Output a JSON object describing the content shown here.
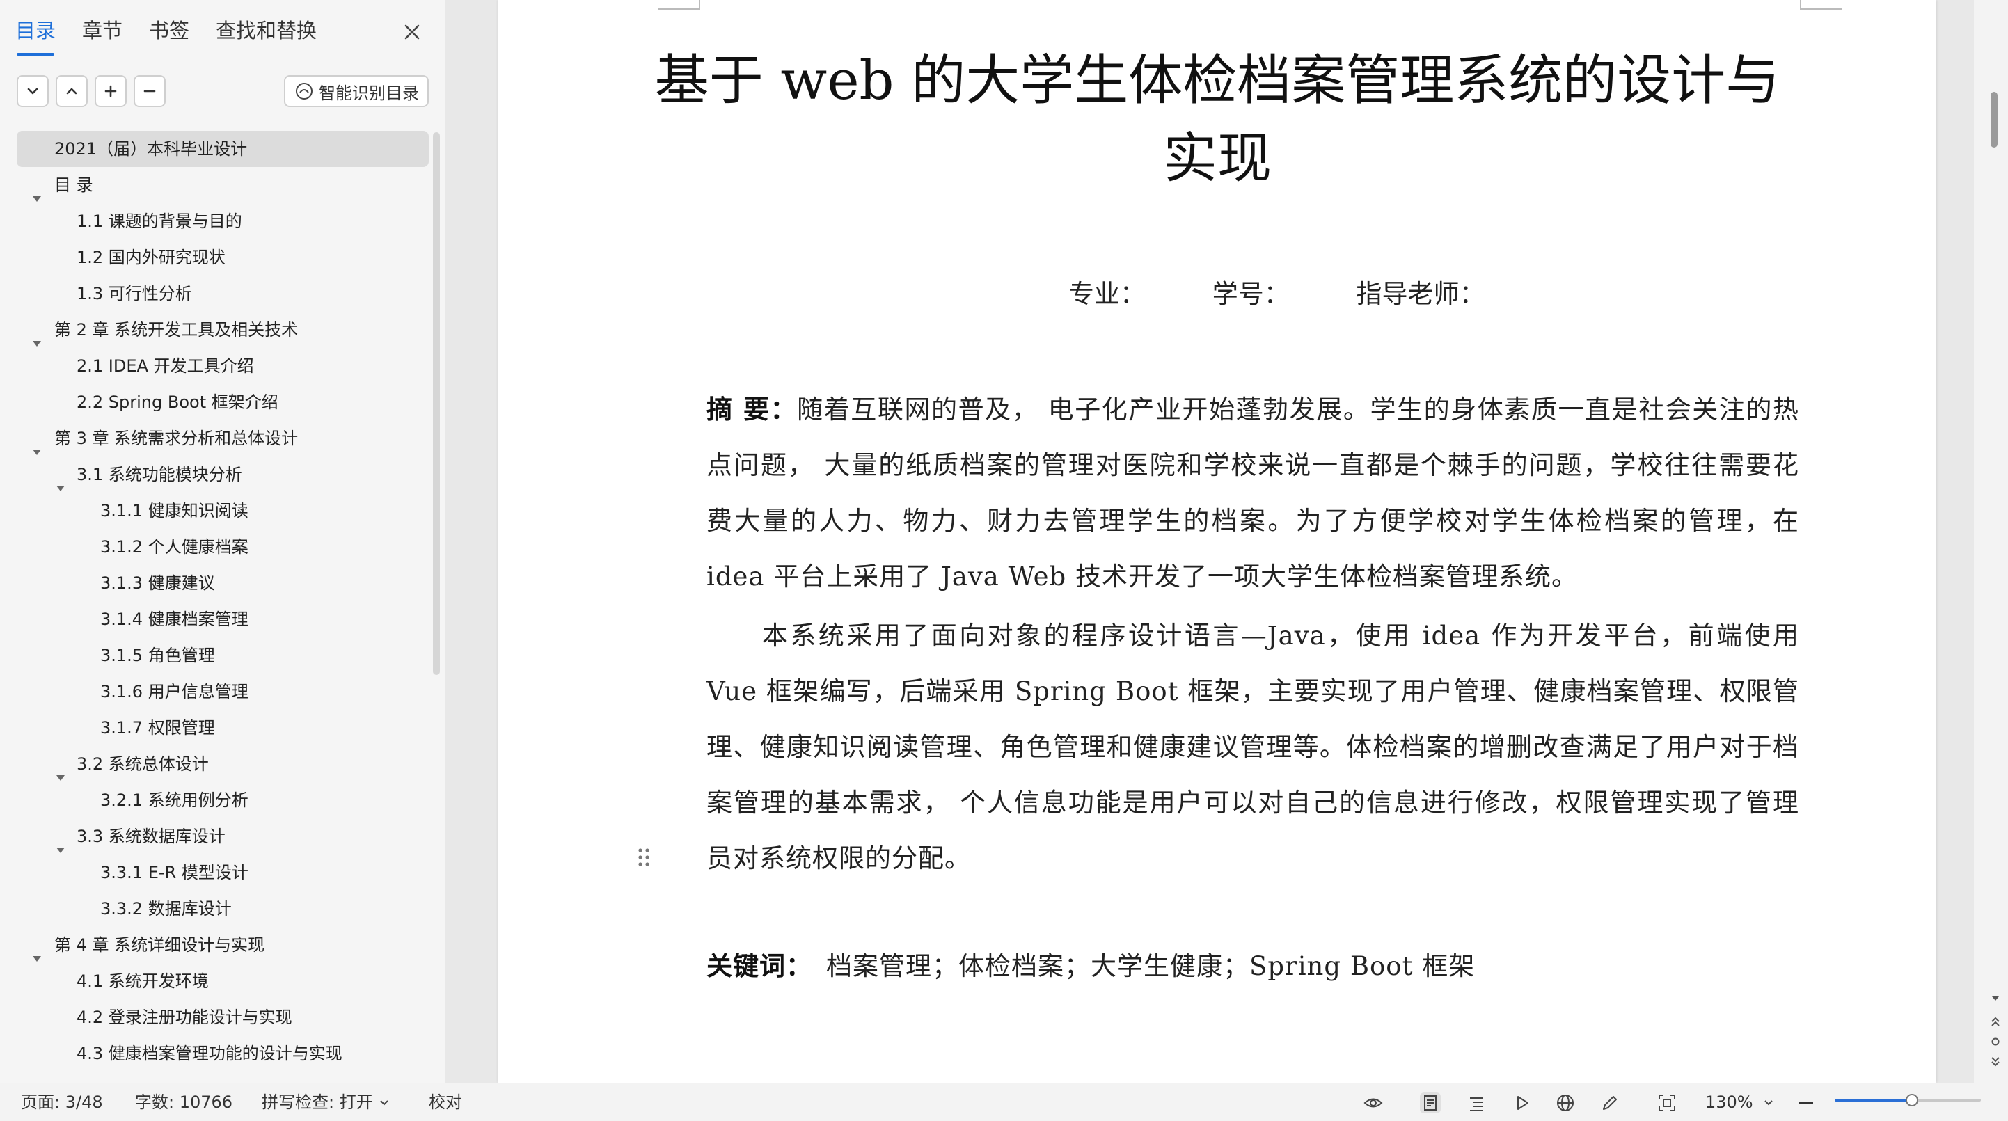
{
  "sidebar": {
    "tabs": [
      {
        "label": "目录",
        "active": true
      },
      {
        "label": "章节"
      },
      {
        "label": "书签"
      },
      {
        "label": "查找和替换"
      }
    ],
    "smart_button": "智能识别目录",
    "toc": [
      {
        "label": "2021（届）本科毕业设计",
        "level": 0,
        "expanded": null,
        "selected": true
      },
      {
        "label": "目  录",
        "level": 0,
        "expanded": true
      },
      {
        "label": "1.1 课题的背景与目的",
        "level": 1
      },
      {
        "label": "1.2 国内外研究现状",
        "level": 1
      },
      {
        "label": "1.3 可行性分析",
        "level": 1
      },
      {
        "label": "第 2 章 系统开发工具及相关技术",
        "level": 0,
        "expanded": true
      },
      {
        "label": "2.1 IDEA 开发工具介绍",
        "level": 1
      },
      {
        "label": "2.2  Spring Boot 框架介绍",
        "level": 1
      },
      {
        "label": "第 3 章 系统需求分析和总体设计",
        "level": 0,
        "expanded": true
      },
      {
        "label": "3.1 系统功能模块分析",
        "level": 1,
        "expanded": true
      },
      {
        "label": "3.1.1 健康知识阅读",
        "level": 2
      },
      {
        "label": "3.1.2 个人健康档案",
        "level": 2
      },
      {
        "label": "3.1.3 健康建议",
        "level": 2
      },
      {
        "label": "3.1.4 健康档案管理",
        "level": 2
      },
      {
        "label": "3.1.5 角色管理",
        "level": 2
      },
      {
        "label": "3.1.6 用户信息管理",
        "level": 2
      },
      {
        "label": "3.1.7 权限管理",
        "level": 2
      },
      {
        "label": "3.2 系统总体设计",
        "level": 1,
        "expanded": true
      },
      {
        "label": "3.2.1 系统用例分析",
        "level": 2
      },
      {
        "label": "3.3 系统数据库设计",
        "level": 1,
        "expanded": true
      },
      {
        "label": "3.3.1 E-R 模型设计",
        "level": 2
      },
      {
        "label": "3.3.2 数据库设计",
        "level": 2
      },
      {
        "label": "第 4 章 系统详细设计与实现",
        "level": 0,
        "expanded": true
      },
      {
        "label": "4.1 系统开发环境",
        "level": 1
      },
      {
        "label": "4.2 登录注册功能设计与实现",
        "level": 1
      },
      {
        "label": "4.3 健康档案管理功能的设计与实现",
        "level": 1
      }
    ]
  },
  "document": {
    "title_line1": "基于 web 的大学生体检档案管理系统的设计与",
    "title_line2": "实现",
    "meta": {
      "major": "专业：",
      "student_id": "学号：",
      "advisor": "指导老师："
    },
    "abstract_label": "摘 要：",
    "abstract_p1": "随着互联网的普及， 电子化产业开始蓬勃发展。学生的身体素质一直是社会关注的热点问题， 大量的纸质档案的管理对医院和学校来说一直都是个棘手的问题，学校往往需要花费大量的人力、物力、财力去管理学生的档案。为了方便学校对学生体检档案的管理，在 idea 平台上采用了 Java Web 技术开发了一项大学生体检档案管理系统。",
    "abstract_p2": "本系统采用了面向对象的程序设计语言—Java，使用 idea 作为开发平台，前端使用 Vue 框架编写，后端采用 Spring Boot 框架，主要实现了用户管理、健康档案管理、权限管理、健康知识阅读管理、角色管理和健康建议管理等。体检档案的增删改查满足了用户对于档案管理的基本需求， 个人信息功能是用户可以对自己的信息进行修改，权限管理实现了管理员对系统权限的分配。",
    "keywords_label": "关键词：",
    "keywords": "档案管理；体检档案；大学生健康；Spring Boot 框架"
  },
  "statusbar": {
    "page": "页面: 3/48",
    "word_count": "字数: 10766",
    "spell_check": "拼写检查: 打开",
    "proofread": "校对",
    "zoom": "130%",
    "zoom_level_fraction": 0.53
  },
  "colors": {
    "accent": "#1e6fd9",
    "sidebar_bg": "#f5f5f5",
    "canvas_bg": "#e8e8e8"
  }
}
